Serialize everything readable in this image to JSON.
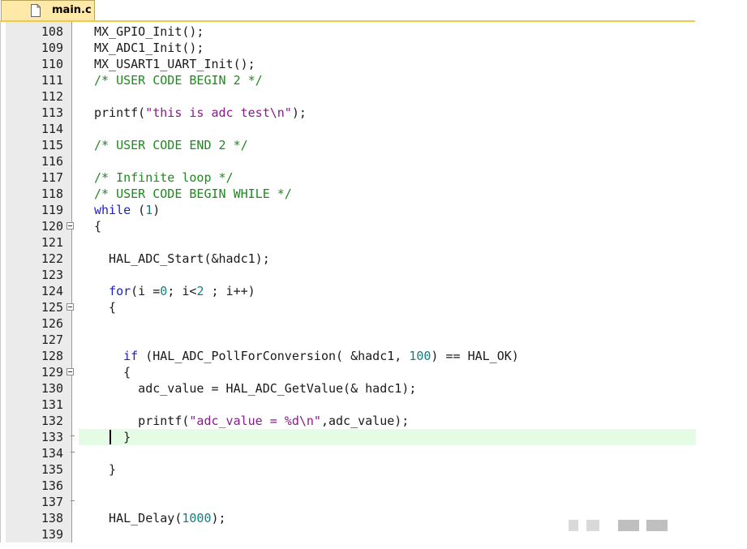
{
  "tab": {
    "title": "main.c",
    "icon": "file-icon"
  },
  "colors": {
    "keyword": "#1b1bd4",
    "comment": "#1e8a1e",
    "string": "#8a1a8a",
    "number": "#118080",
    "current_line": "#e4fbe4",
    "tab_bg": "#ffe9a8"
  },
  "editor": {
    "current_line": "133",
    "lines": [
      {
        "n": "108",
        "parts": [
          [
            "",
            "MX_GPIO_Init();"
          ]
        ]
      },
      {
        "n": "109",
        "parts": [
          [
            "",
            "MX_ADC1_Init();"
          ]
        ]
      },
      {
        "n": "110",
        "parts": [
          [
            "",
            "MX_USART1_UART_Init();"
          ]
        ]
      },
      {
        "n": "111",
        "parts": [
          [
            "cm",
            "/* USER CODE BEGIN 2 */"
          ]
        ]
      },
      {
        "n": "112",
        "parts": []
      },
      {
        "n": "113",
        "parts": [
          [
            "",
            "printf("
          ],
          [
            "str",
            "\"this is adc test\\n\""
          ],
          [
            "",
            ");"
          ]
        ]
      },
      {
        "n": "114",
        "parts": []
      },
      {
        "n": "115",
        "parts": [
          [
            "cm",
            "/* USER CODE END 2 */"
          ]
        ]
      },
      {
        "n": "116",
        "parts": []
      },
      {
        "n": "117",
        "parts": [
          [
            "cm",
            "/* Infinite loop */"
          ]
        ]
      },
      {
        "n": "118",
        "parts": [
          [
            "cm",
            "/* USER CODE BEGIN WHILE */"
          ]
        ]
      },
      {
        "n": "119",
        "parts": [
          [
            "kw",
            "while"
          ],
          [
            "",
            " ("
          ],
          [
            "num",
            "1"
          ],
          [
            "",
            ")"
          ]
        ]
      },
      {
        "n": "120",
        "fold": "open",
        "parts": [
          [
            "",
            "{"
          ]
        ]
      },
      {
        "n": "121",
        "parts": []
      },
      {
        "n": "122",
        "parts": [
          [
            "",
            "  HAL_ADC_Start(&hadc1);"
          ]
        ]
      },
      {
        "n": "123",
        "parts": []
      },
      {
        "n": "124",
        "parts": [
          [
            "",
            "  "
          ],
          [
            "kw",
            "for"
          ],
          [
            "",
            "(i ="
          ],
          [
            "num",
            "0"
          ],
          [
            "",
            "; i<"
          ],
          [
            "num",
            "2"
          ],
          [
            "",
            " ; i++)"
          ]
        ]
      },
      {
        "n": "125",
        "fold": "open",
        "parts": [
          [
            "",
            "  {"
          ]
        ]
      },
      {
        "n": "126",
        "parts": []
      },
      {
        "n": "127",
        "parts": []
      },
      {
        "n": "128",
        "parts": [
          [
            "",
            "    "
          ],
          [
            "kw",
            "if"
          ],
          [
            "",
            " (HAL_ADC_PollForConversion( &hadc1, "
          ],
          [
            "num",
            "100"
          ],
          [
            "",
            ") == HAL_OK)"
          ]
        ]
      },
      {
        "n": "129",
        "fold": "open",
        "parts": [
          [
            "",
            "    {"
          ]
        ]
      },
      {
        "n": "130",
        "parts": [
          [
            "",
            "      adc_value = HAL_ADC_GetValue(& hadc1);"
          ]
        ]
      },
      {
        "n": "131",
        "parts": []
      },
      {
        "n": "132",
        "parts": [
          [
            "",
            "      printf("
          ],
          [
            "str",
            "\"adc_value = %d\\n\""
          ],
          [
            "",
            ",adc_value);"
          ]
        ]
      },
      {
        "n": "133",
        "fold": "end",
        "parts": [
          [
            "",
            "    }"
          ]
        ]
      },
      {
        "n": "134",
        "fold": "end",
        "parts": []
      },
      {
        "n": "135",
        "parts": [
          [
            "",
            "  }"
          ]
        ]
      },
      {
        "n": "136",
        "parts": []
      },
      {
        "n": "137",
        "fold": "end",
        "parts": []
      },
      {
        "n": "138",
        "parts": [
          [
            "",
            "  HAL_Delay("
          ],
          [
            "num",
            "1000"
          ],
          [
            "",
            ");"
          ]
        ]
      },
      {
        "n": "139",
        "parts": []
      }
    ]
  }
}
